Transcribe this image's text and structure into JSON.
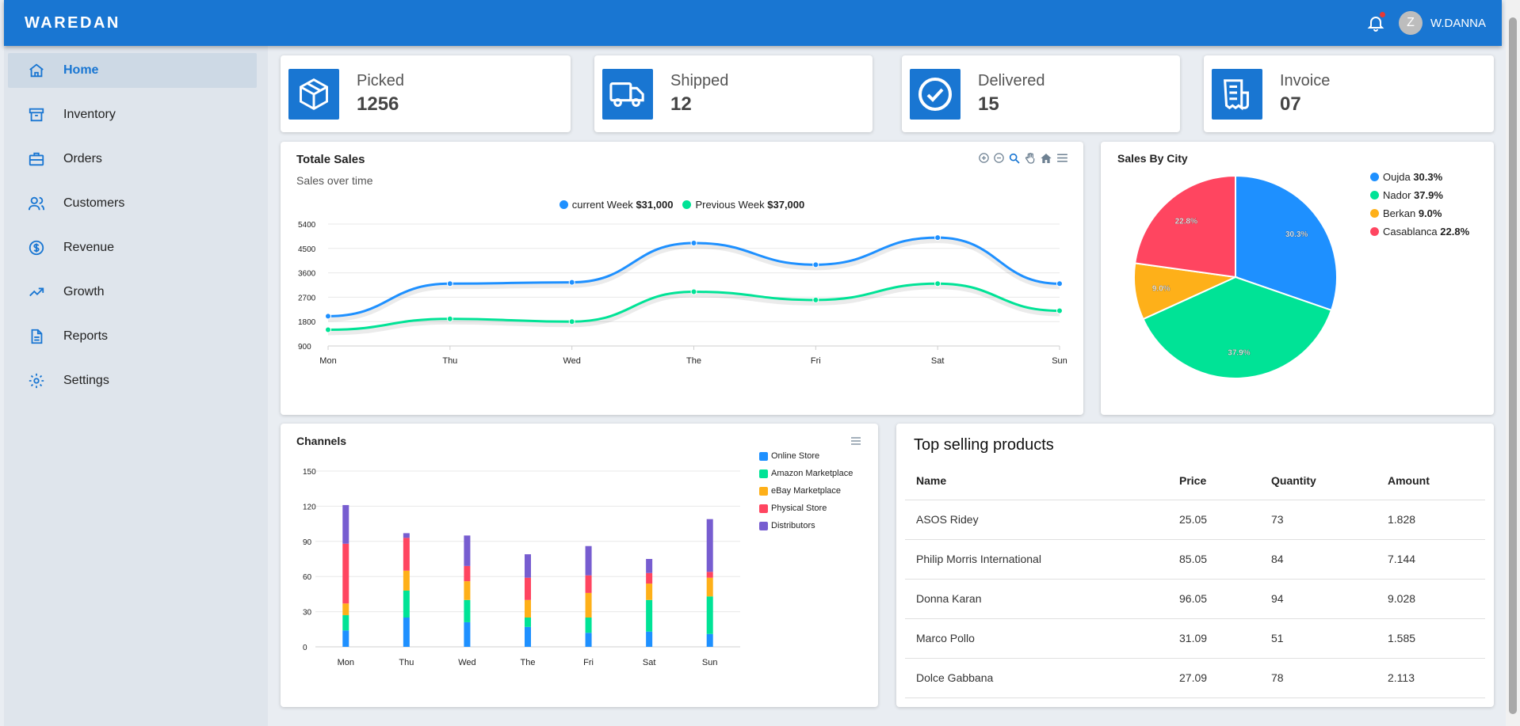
{
  "header": {
    "logo": "WAREDAN",
    "avatar_letter": "Z",
    "username": "W.DANNA",
    "notification_icon": "bell-icon"
  },
  "sidebar": {
    "items": [
      {
        "label": "Home",
        "icon": "home-icon",
        "active": true
      },
      {
        "label": "Inventory",
        "icon": "archive-icon"
      },
      {
        "label": "Orders",
        "icon": "briefcase-icon"
      },
      {
        "label": "Customers",
        "icon": "users-icon"
      },
      {
        "label": "Revenue",
        "icon": "dollar-circle-icon"
      },
      {
        "label": "Growth",
        "icon": "trending-up-icon"
      },
      {
        "label": "Reports",
        "icon": "document-icon"
      },
      {
        "label": "Settings",
        "icon": "gear-icon"
      }
    ]
  },
  "stats": [
    {
      "title": "Picked",
      "value": "1256",
      "icon": "box-icon"
    },
    {
      "title": "Shipped",
      "value": "12",
      "icon": "truck-icon"
    },
    {
      "title": "Delivered",
      "value": "15",
      "icon": "check-circle-icon"
    },
    {
      "title": "Invoice",
      "value": "07",
      "icon": "receipt-icon"
    }
  ],
  "colors": {
    "primary": "#1976d2",
    "blue": "#1e90ff",
    "green": "#00e396",
    "orange": "#feb019",
    "red": "#ff4560",
    "purple": "#775dd0"
  },
  "sales": {
    "title": "Totale Sales",
    "subtitle": "Sales over time",
    "legend": [
      {
        "label": "current Week",
        "value": "$31,000"
      },
      {
        "label": "Previous Week",
        "value": "$37,000"
      }
    ],
    "toolbar_icons": [
      "zoom-in-icon",
      "zoom-out-icon",
      "magnifier-icon",
      "pan-hand-icon",
      "reset-home-icon",
      "menu-icon"
    ]
  },
  "city": {
    "title": "Sales By City",
    "legend": [
      {
        "label": "Oujda",
        "value": "30.3%"
      },
      {
        "label": "Nador",
        "value": "37.9%"
      },
      {
        "label": "Berkan",
        "value": "9.0%"
      },
      {
        "label": "Casablanca",
        "value": "22.8%"
      }
    ]
  },
  "channels": {
    "title": "Channels",
    "menu_icon": "menu-icon"
  },
  "products": {
    "title": "Top selling products",
    "columns": [
      "Name",
      "Price",
      "Quantity",
      "Amount"
    ],
    "rows": [
      [
        "ASOS Ridey",
        "25.05",
        "73",
        "1.828"
      ],
      [
        "Philip Morris International",
        "85.05",
        "84",
        "7.144"
      ],
      [
        "Donna Karan",
        "96.05",
        "94",
        "9.028"
      ],
      [
        "Marco Pollo",
        "31.09",
        "51",
        "1.585"
      ],
      [
        "Dolce Gabbana",
        "27.09",
        "78",
        "2.113"
      ]
    ]
  },
  "chart_data": [
    {
      "type": "line",
      "title": "Totale Sales",
      "subtitle": "Sales over time",
      "categories": [
        "Mon",
        "Thu",
        "Wed",
        "The",
        "Fri",
        "Sat",
        "Sun"
      ],
      "yticks": [
        "5400",
        "4500",
        "3600",
        "2700",
        "1800",
        "900"
      ],
      "ylim": [
        900,
        5400
      ],
      "series": [
        {
          "name": "current Week",
          "values": [
            2000,
            3200,
            3250,
            4700,
            3900,
            4900,
            3200
          ]
        },
        {
          "name": "Previous Week",
          "values": [
            1500,
            1900,
            1800,
            2900,
            2600,
            3200,
            2200
          ]
        }
      ],
      "grid": true,
      "legend": "top-center"
    },
    {
      "type": "pie",
      "title": "Sales By City",
      "labels": [
        "Oujda",
        "Nador",
        "Berkan",
        "Casablanca"
      ],
      "values": [
        30.3,
        37.9,
        9.0,
        22.8
      ],
      "value_labels": [
        "30.3%",
        "37.9%",
        "9.0%",
        "22.8%"
      ],
      "legend": "right"
    },
    {
      "type": "bar",
      "stacked": true,
      "title": "Channels",
      "categories": [
        "Mon",
        "Thu",
        "Wed",
        "The",
        "Fri",
        "Sat",
        "Sun"
      ],
      "yticks": [
        "150",
        "120",
        "90",
        "60",
        "30",
        "0"
      ],
      "ylim": [
        0,
        150
      ],
      "series": [
        {
          "name": "Online Store",
          "values": [
            14,
            25,
            21,
            17,
            12,
            13,
            11
          ]
        },
        {
          "name": "Amazon Marketplace",
          "values": [
            13,
            23,
            19,
            8,
            13,
            27,
            32
          ]
        },
        {
          "name": "eBay Marketplace",
          "values": [
            10,
            17,
            16,
            15,
            21,
            14,
            16
          ]
        },
        {
          "name": "Physical Store",
          "values": [
            51,
            28,
            13,
            19,
            15,
            9,
            5
          ]
        },
        {
          "name": "Distributors",
          "values": [
            33,
            4,
            26,
            20,
            25,
            12,
            45
          ]
        }
      ],
      "legend": "right"
    }
  ]
}
